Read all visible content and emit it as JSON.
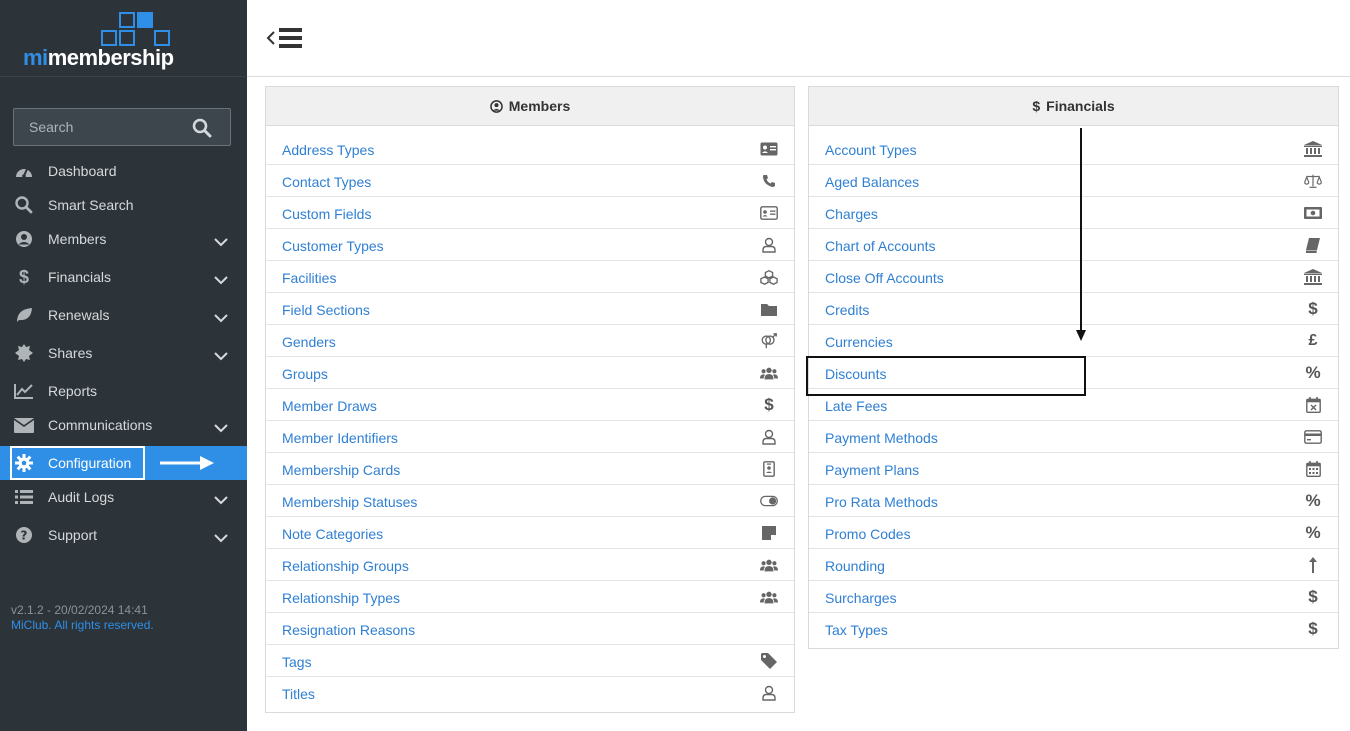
{
  "brand": {
    "logo_prefix": "mi",
    "logo_suffix": "membership"
  },
  "search": {
    "placeholder": "Search"
  },
  "nav": [
    {
      "label": "Dashboard",
      "icon": "dashboard-icon",
      "has_chevron": false
    },
    {
      "label": "Smart Search",
      "icon": "search-icon",
      "has_chevron": false
    },
    {
      "label": "Members",
      "icon": "user-circle-icon",
      "has_chevron": true
    },
    {
      "label": "Financials",
      "icon": "dollar-icon",
      "has_chevron": true
    },
    {
      "label": "Renewals",
      "icon": "leaf-icon",
      "has_chevron": true
    },
    {
      "label": "Shares",
      "icon": "certificate-icon",
      "has_chevron": true
    },
    {
      "label": "Reports",
      "icon": "line-chart-icon",
      "has_chevron": false
    },
    {
      "label": "Communications",
      "icon": "envelope-icon",
      "has_chevron": true
    },
    {
      "label": "Configuration",
      "icon": "gear-icon",
      "has_chevron": false,
      "active": true
    },
    {
      "label": "Audit Logs",
      "icon": "list-icon",
      "has_chevron": true
    },
    {
      "label": "Support",
      "icon": "question-icon",
      "has_chevron": true
    }
  ],
  "footer": {
    "version": "v2.1.2 - 20/02/2024 14:41",
    "rights": "MiClub. All rights reserved."
  },
  "colors": {
    "sidebar": "#2c3339",
    "accent": "#2f8fe6",
    "link": "#2f7fd3"
  },
  "members_panel": {
    "title": "Members",
    "items": [
      {
        "label": "Address Types",
        "icon": "address-card-icon"
      },
      {
        "label": "Contact Types",
        "icon": "phone-icon"
      },
      {
        "label": "Custom Fields",
        "icon": "id-card-icon"
      },
      {
        "label": "Customer Types",
        "icon": "user-outline-icon"
      },
      {
        "label": "Facilities",
        "icon": "cubes-icon"
      },
      {
        "label": "Field Sections",
        "icon": "folder-icon"
      },
      {
        "label": "Genders",
        "icon": "genderless-icon"
      },
      {
        "label": "Groups",
        "icon": "users-icon"
      },
      {
        "label": "Member Draws",
        "icon": "dollar-icon"
      },
      {
        "label": "Member Identifiers",
        "icon": "user-outline-icon"
      },
      {
        "label": "Membership Cards",
        "icon": "id-badge-icon"
      },
      {
        "label": "Membership Statuses",
        "icon": "toggle-icon"
      },
      {
        "label": "Note Categories",
        "icon": "sticky-note-icon"
      },
      {
        "label": "Relationship Groups",
        "icon": "users-icon"
      },
      {
        "label": "Relationship Types",
        "icon": "users-icon"
      },
      {
        "label": "Resignation Reasons",
        "icon": ""
      },
      {
        "label": "Tags",
        "icon": "tag-icon"
      },
      {
        "label": "Titles",
        "icon": "user-outline-icon"
      }
    ]
  },
  "financials_panel": {
    "title": "Financials",
    "items": [
      {
        "label": "Account Types",
        "icon": "bank-icon"
      },
      {
        "label": "Aged Balances",
        "icon": "balance-scale-icon"
      },
      {
        "label": "Charges",
        "icon": "money-bill-icon"
      },
      {
        "label": "Chart of Accounts",
        "icon": "book-icon"
      },
      {
        "label": "Close Off Accounts",
        "icon": "bank-icon"
      },
      {
        "label": "Credits",
        "icon": "dollar-icon"
      },
      {
        "label": "Currencies",
        "icon": "pound-icon"
      },
      {
        "label": "Discounts",
        "icon": "percent-icon"
      },
      {
        "label": "Late Fees",
        "icon": "calendar-times-icon"
      },
      {
        "label": "Payment Methods",
        "icon": "credit-card-icon"
      },
      {
        "label": "Payment Plans",
        "icon": "calendar-icon"
      },
      {
        "label": "Pro Rata Methods",
        "icon": "percent-icon"
      },
      {
        "label": "Promo Codes",
        "icon": "percent-icon"
      },
      {
        "label": "Rounding",
        "icon": "arrow-up-icon"
      },
      {
        "label": "Surcharges",
        "icon": "dollar-icon"
      },
      {
        "label": "Tax Types",
        "icon": "dollar-icon"
      }
    ]
  }
}
